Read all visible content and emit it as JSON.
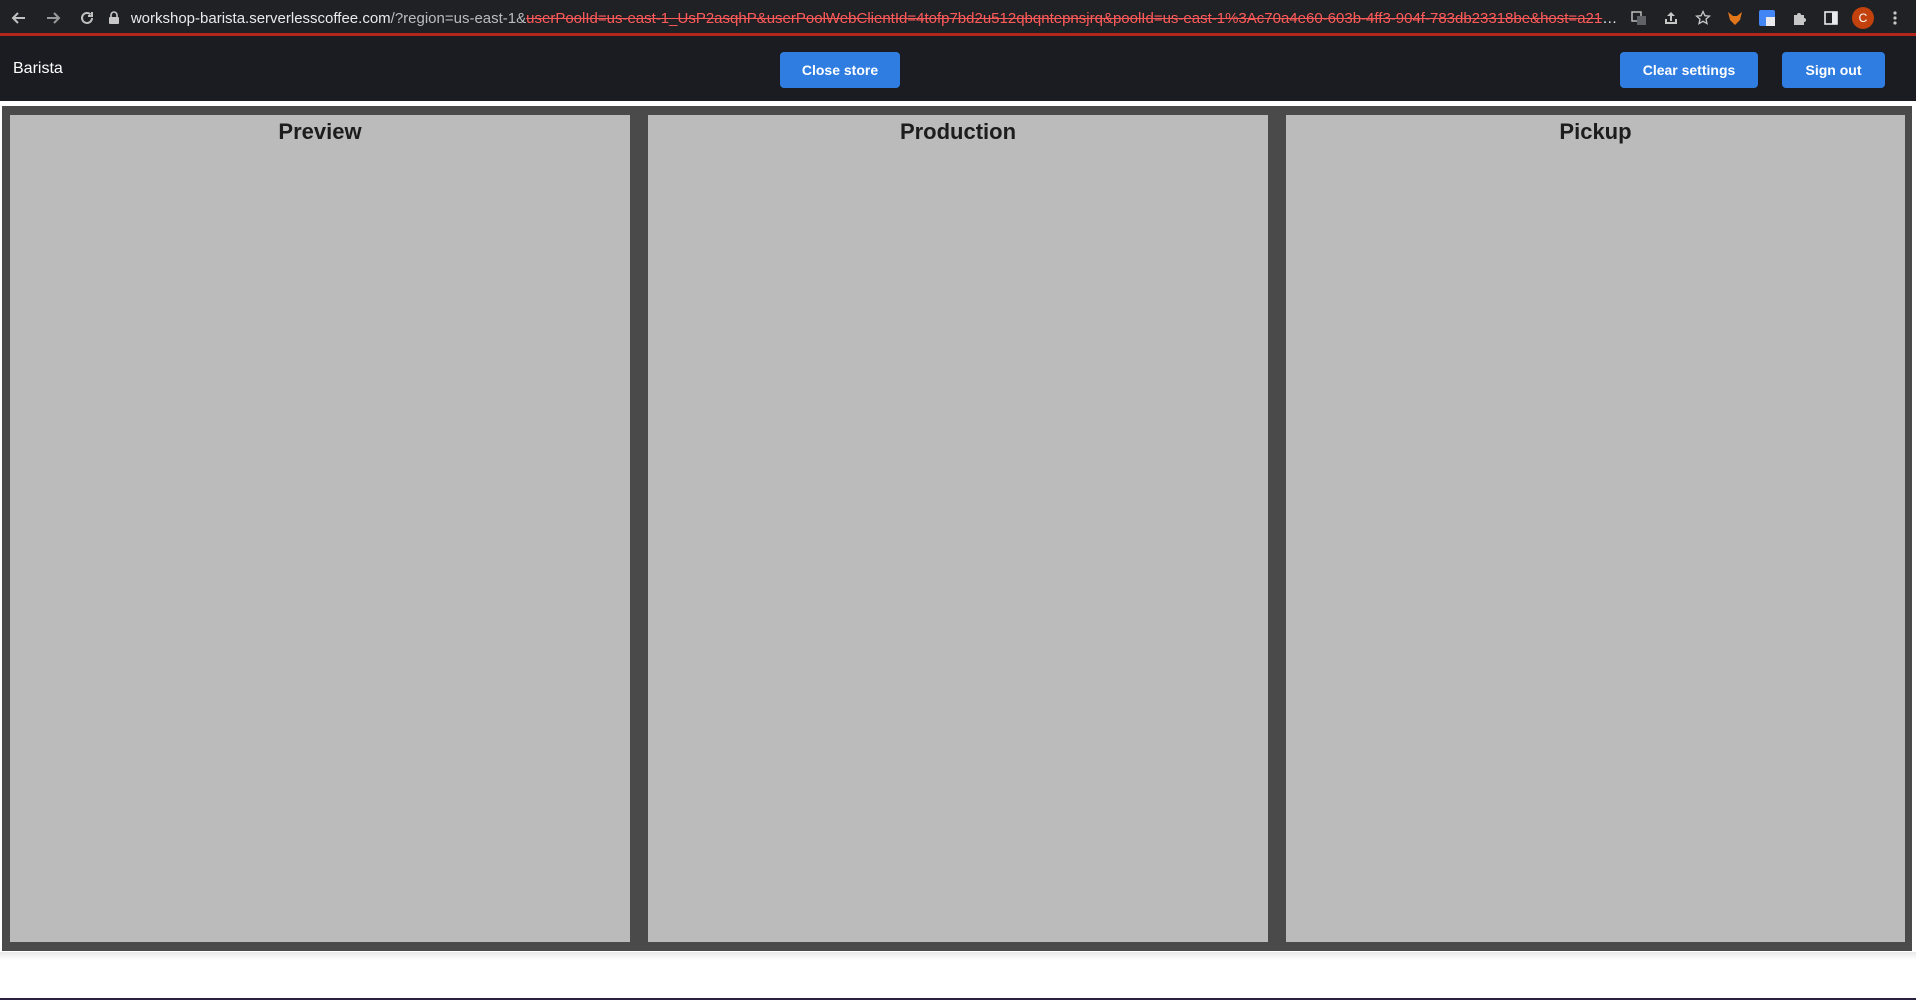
{
  "browser": {
    "url_domain": "workshop-barista.serverlesscoffee.com",
    "url_visible": "/?region=us-east-1&",
    "url_redacted": "userPoolId=us-east-1_UsP2asqhP&userPoolWebClientId=4tofp7bd2u512qbqntepnsjrq&poolId=us-east-1%3Ac70a4e60-603b-4ff3-904f-783db23318be&host=a214a6znm33od...",
    "profile_initial": "C"
  },
  "app": {
    "title": "Barista",
    "close_store_label": "Close store",
    "clear_settings_label": "Clear settings",
    "sign_out_label": "Sign out"
  },
  "columns": [
    {
      "title": "Preview"
    },
    {
      "title": "Production"
    },
    {
      "title": "Pickup"
    }
  ],
  "colors": {
    "accent": "#2f7de1",
    "header_bg": "#1b1c22",
    "board_bg": "#4a4a4a",
    "column_bg": "#bbbbbb"
  }
}
